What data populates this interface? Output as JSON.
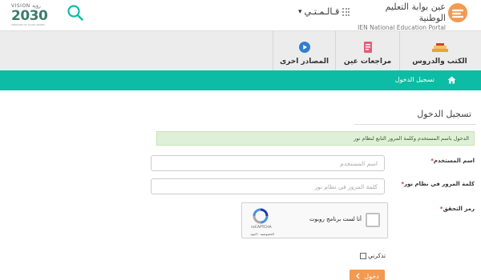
{
  "header": {
    "vision_small": "VISION رؤية",
    "vision_year": "2030",
    "vision_sub": "KINGDOM OF SAUDI ARABIA",
    "language_label": "قـالـمـتـي",
    "portal_name_ar": "عين بوابة التعليم الوطنية",
    "portal_name_en": "IEN National Education Portal",
    "icons": [
      "search-icon",
      "apps-grid-icon",
      "chevron-down-icon",
      "ien-logo-icon",
      "vision-2030-logo"
    ]
  },
  "nav": {
    "items": [
      {
        "label": "الكتب والدروس",
        "icon": "books-icon",
        "color": "#e8a33c"
      },
      {
        "label": "مراجعات عين",
        "icon": "review-icon",
        "color": "#e85a7a"
      },
      {
        "label": "المصادر اخرى",
        "icon": "media-icon",
        "color": "#2f7fd0"
      }
    ]
  },
  "breadcrumb": {
    "current": "تسجيل الدخول",
    "icon": "home-icon"
  },
  "login": {
    "title": "تسجيل الدخول",
    "alert": "الدخول باسم المستخدم وكلمة المرور التابع لنظام نور",
    "username_label": "اسم المستخدم",
    "username_placeholder": "اسم المستخدم",
    "password_label": "كلمة المرور في نظام نور",
    "password_placeholder": "كلمة المرور في نظام نور",
    "captcha_label": "رمز التحقق",
    "required_mark": "*",
    "captcha_text": "أنا لست برنامج روبوت",
    "captcha_brand": "reCAPTCHA",
    "captcha_terms": "الخصوصية - البنود",
    "remember_label": "تذكرني",
    "submit_label": "دخول"
  },
  "colors": {
    "accent": "#0dbca4",
    "button": "#f39a52",
    "alert_bg": "#dff0d8",
    "nav_bg": "#ececec"
  }
}
